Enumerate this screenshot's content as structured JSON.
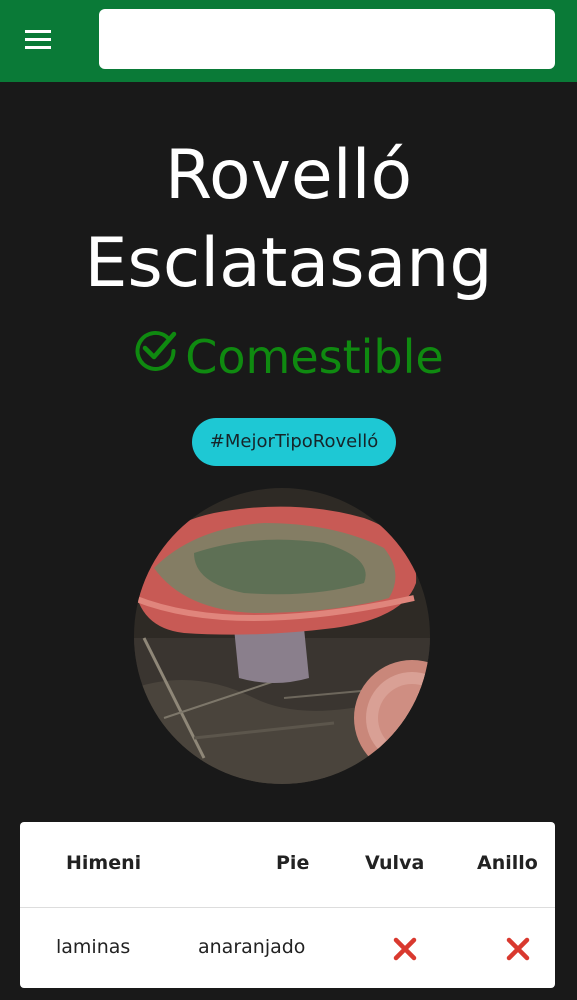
{
  "header": {
    "menu_icon": "hamburger-menu-icon",
    "search": {
      "value": "",
      "placeholder": ""
    }
  },
  "species": {
    "name": "Rovelló Esclatasang",
    "name_line1": "Rovelló",
    "name_line2": "Esclatasang",
    "edibility": "Comestible",
    "edibility_icon": "check-circle-icon",
    "hashtag": "#MejorTipoRovelló",
    "photo": "mushroom-photo"
  },
  "table": {
    "headers": [
      "Himeni",
      "",
      "Pie",
      "Vulva",
      "Anillo"
    ],
    "rows": [
      {
        "himeni": "laminas",
        "color": "anaranjado",
        "pie": "",
        "vulva_icon": "cross-mark-icon",
        "anillo_icon": "cross-mark-icon"
      }
    ]
  },
  "colors": {
    "topbar": "#0a7a37",
    "background": "#191919",
    "edible": "#0f8a10",
    "hashtag_bg": "#1ec8d4",
    "cross": "#d9392f"
  }
}
